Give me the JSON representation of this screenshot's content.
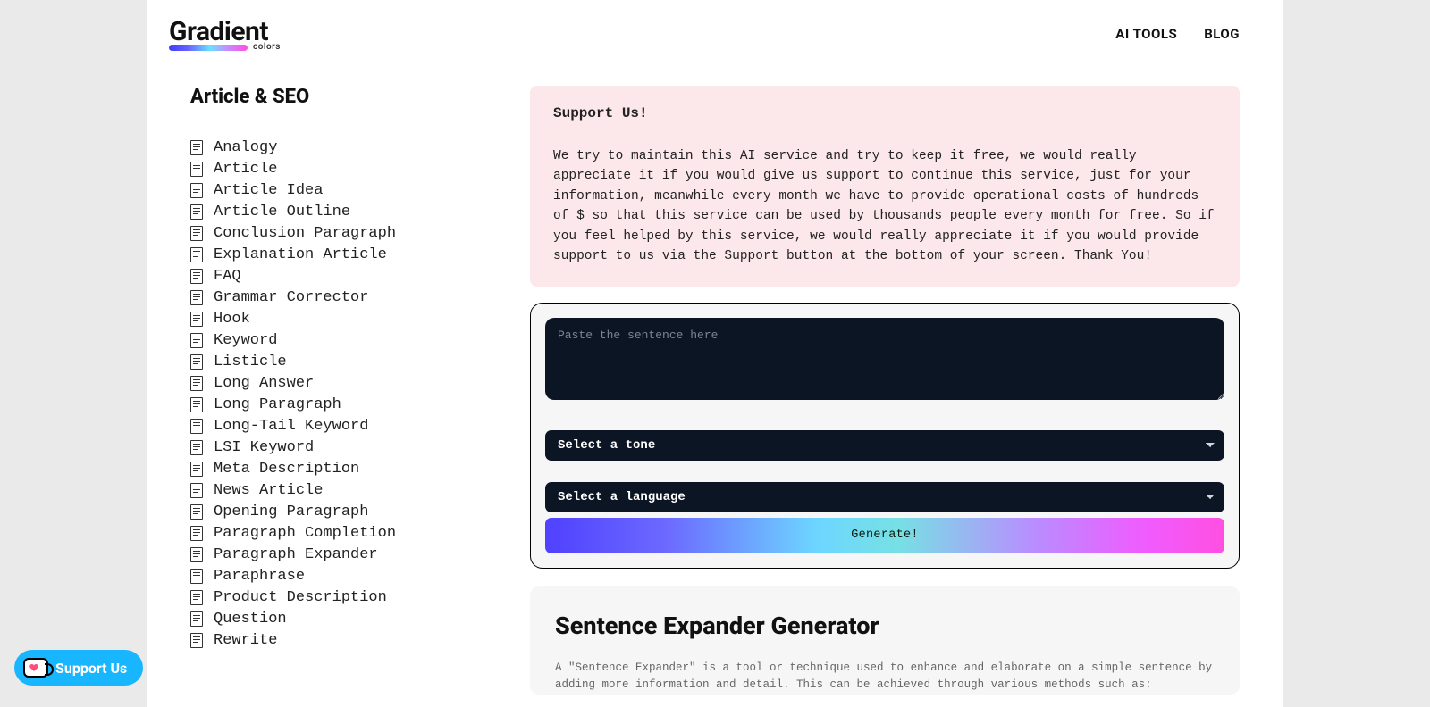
{
  "logo": {
    "main": "Gradient",
    "sub": "colors"
  },
  "nav": {
    "ai_tools": "AI TOOLS",
    "blog": "BLOG"
  },
  "sidebar": {
    "heading": "Article & SEO",
    "items": [
      "Analogy",
      "Article",
      "Article Idea",
      "Article Outline",
      "Conclusion Paragraph",
      "Explanation Article",
      "FAQ",
      "Grammar Corrector",
      "Hook",
      "Keyword",
      "Listicle",
      "Long Answer",
      "Long Paragraph",
      "Long-Tail Keyword",
      "LSI Keyword",
      "Meta Description",
      "News Article",
      "Opening Paragraph",
      "Paragraph Completion",
      "Paragraph Expander",
      "Paraphrase",
      "Product Description",
      "Question",
      "Rewrite"
    ]
  },
  "support_box": {
    "title": "Support Us!",
    "body": "We try to maintain this AI service and try to keep it free, we would really appreciate it if you would give us support to continue this service, just for your information, meanwhile every month we have to provide operational costs of hundreds of $ so that this service can be used by thousands people every month for free. So if you feel helped by this service, we would really appreciate it if you would provide support to us via the Support button at the bottom of your screen. Thank You!"
  },
  "tool": {
    "textarea_placeholder": "Paste the sentence here",
    "tone_placeholder": "Select a tone",
    "language_placeholder": "Select a language",
    "generate_label": "Generate!"
  },
  "article": {
    "title": "Sentence Expander Generator",
    "body": "A \"Sentence Expander\" is a tool or technique used to enhance and elaborate on a simple sentence by adding more information and detail. This can be achieved through various methods such as:"
  },
  "support_pill": {
    "label": "Support Us"
  }
}
